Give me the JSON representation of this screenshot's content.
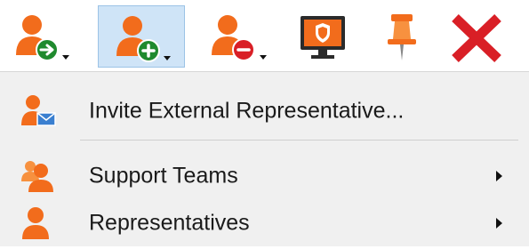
{
  "toolbar": {
    "buttons": [
      {
        "icon": "user-transfer-icon",
        "pressed": false,
        "has_dropdown": true
      },
      {
        "icon": "user-add-icon",
        "pressed": true,
        "has_dropdown": true
      },
      {
        "icon": "user-remove-icon",
        "pressed": false,
        "has_dropdown": true
      },
      {
        "icon": "monitor-shield-icon",
        "pressed": false,
        "has_dropdown": false
      },
      {
        "icon": "pin-icon",
        "pressed": false,
        "has_dropdown": false
      },
      {
        "icon": "close-icon",
        "pressed": false,
        "has_dropdown": false
      }
    ]
  },
  "menu": {
    "items": [
      {
        "label": "Invite External Representative...",
        "icon": "user-mail-icon",
        "has_submenu": false
      },
      {
        "label": "Support Teams",
        "icon": "user-group-icon",
        "has_submenu": true
      },
      {
        "label": "Representatives",
        "icon": "user-icon",
        "has_submenu": true
      }
    ]
  },
  "colors": {
    "accent_orange": "#f26c1c",
    "pressed_bg": "#cfe4f7",
    "menu_bg": "#f0f0f0",
    "close_red": "#d91f26",
    "add_green": "#1f8a2e"
  }
}
